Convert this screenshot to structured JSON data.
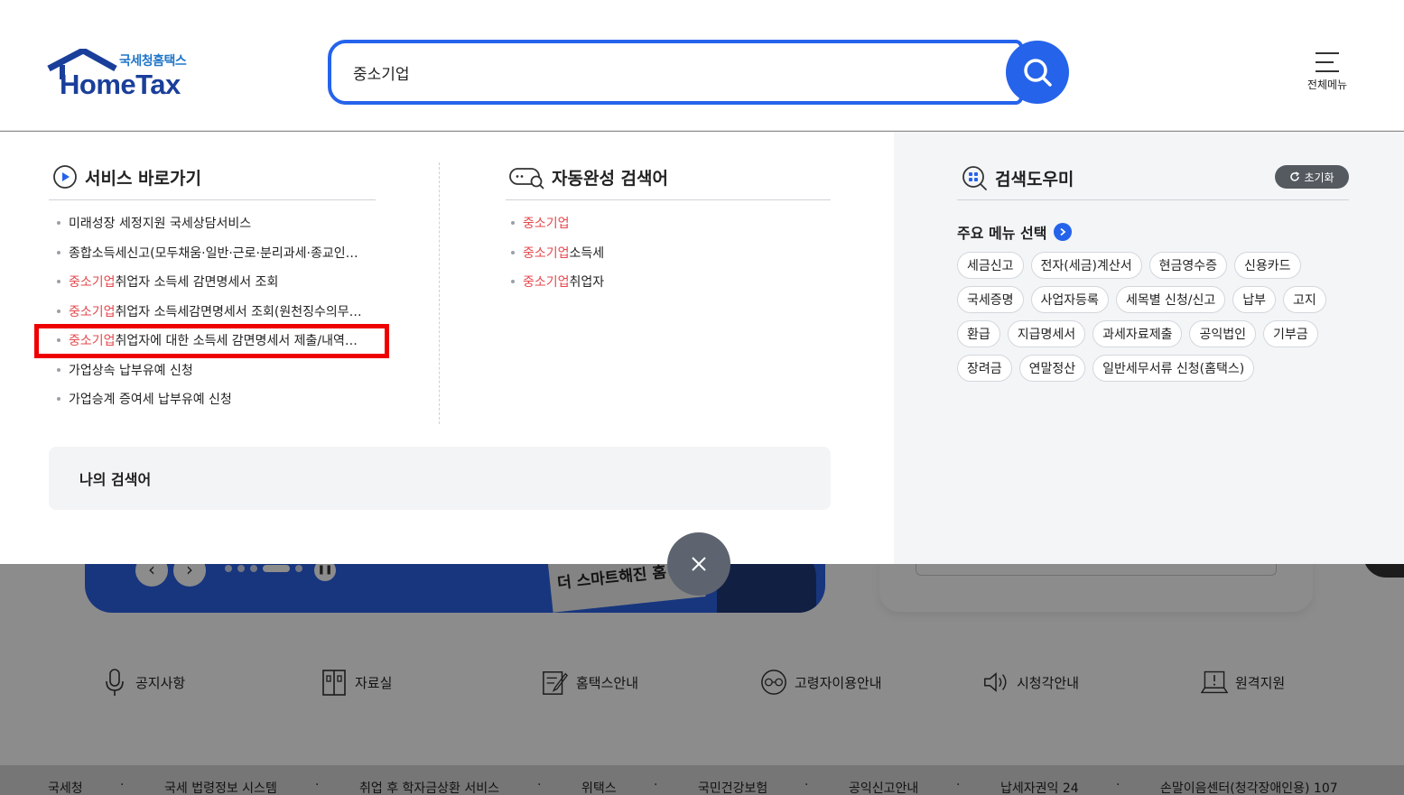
{
  "header": {
    "logo_sub": "국세청홈택스",
    "logo_main": "HomeTax",
    "search_value": "중소기업",
    "all_menu_label": "전체메뉴"
  },
  "service_shortcuts": {
    "title": "서비스 바로가기",
    "items": [
      {
        "highlight": "",
        "text": "미래성장 세정지원 국세상담서비스"
      },
      {
        "highlight": "",
        "text": "종합소득세신고(모두채움·일반·근로·분리과세·종교인…"
      },
      {
        "highlight": "중소기업",
        "text": "취업자 소득세 감면명세서 조회"
      },
      {
        "highlight": "중소기업",
        "text": "취업자 소득세감면명세서 조회(원천징수의무…"
      },
      {
        "highlight": "중소기업",
        "text": "취업자에 대한 소득세 감면명세서 제출/내역…"
      },
      {
        "highlight": "",
        "text": "가업상속 납부유예 신청"
      },
      {
        "highlight": "",
        "text": "가업승계 증여세 납부유예 신청"
      }
    ]
  },
  "autocomplete": {
    "title": "자동완성 검색어",
    "items": [
      {
        "highlight": "중소기업",
        "text": ""
      },
      {
        "highlight": "중소기업",
        "text": "소득세"
      },
      {
        "highlight": "중소기업",
        "text": "취업자"
      }
    ]
  },
  "my_search": {
    "title": "나의 검색어"
  },
  "search_helper": {
    "title": "검색도우미",
    "reset_label": "초기화",
    "menu_select_label": "주요 메뉴 선택",
    "chip_rows": [
      [
        "세금신고",
        "전자(세금)계산서",
        "현금영수증",
        "신용카드"
      ],
      [
        "국세증명",
        "사업자등록",
        "세목별 신청/신고",
        "납부",
        "고지"
      ],
      [
        "환급",
        "지급명세서",
        "과세자료제출",
        "공익법인",
        "기부금"
      ],
      [
        "장려금",
        "연말정산",
        "일반세무서류 신청(홈택스)"
      ]
    ]
  },
  "background": {
    "banner_text": "더 스마트해진 홈",
    "quick_links": [
      {
        "label": "공지사항",
        "icon": "microphone-icon"
      },
      {
        "label": "자료실",
        "icon": "archive-icon"
      },
      {
        "label": "홈택스안내",
        "icon": "guide-icon"
      },
      {
        "label": "고령자이용안내",
        "icon": "senior-icon"
      },
      {
        "label": "시청각안내",
        "icon": "speaker-icon"
      },
      {
        "label": "원격지원",
        "icon": "remote-support-icon"
      }
    ],
    "footer_links": [
      "국세청",
      "국세 법령정보 시스템",
      "취업 후 학자금상환 서비스",
      "위택스",
      "국민건강보험",
      "공익신고안내",
      "납세자권익 24",
      "손말이음센터(청각장애인용) 107"
    ]
  },
  "colors": {
    "accent": "#2563eb",
    "highlight_text": "#e5484d",
    "annotation_box": "#ee0000"
  }
}
